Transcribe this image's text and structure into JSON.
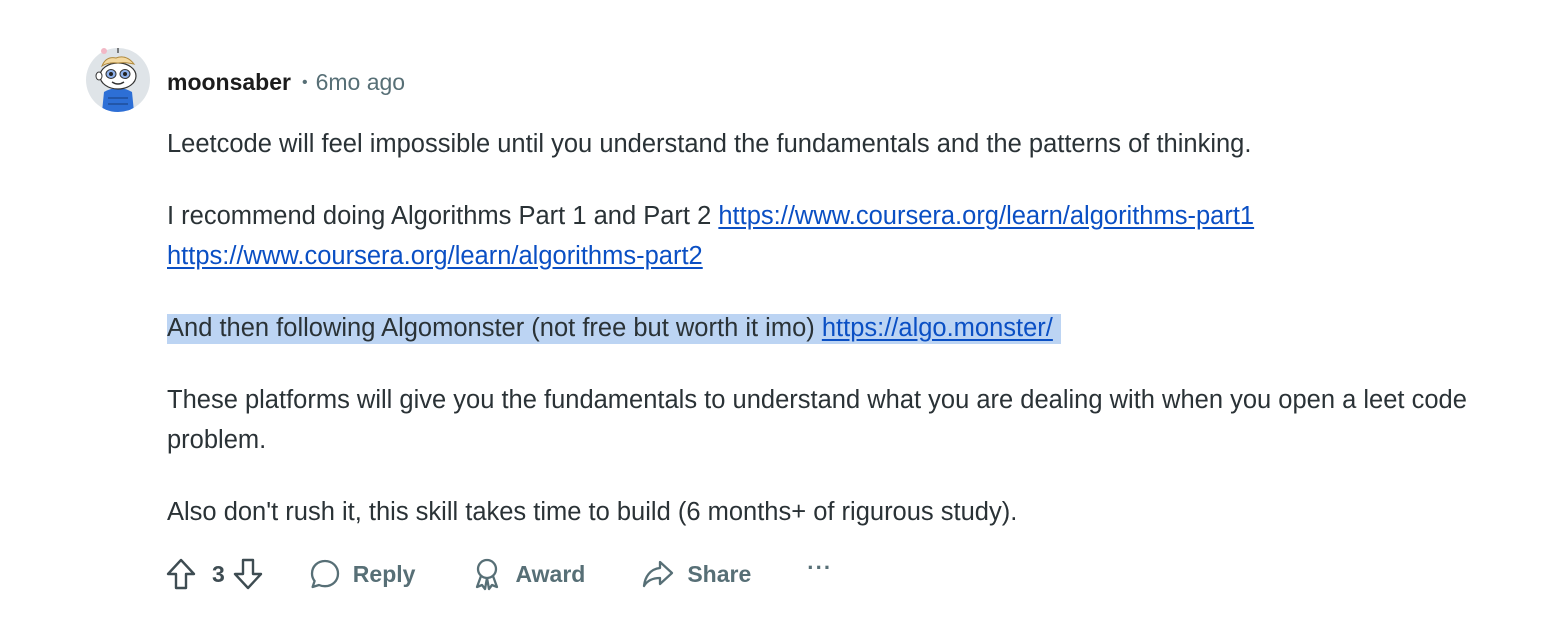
{
  "comment": {
    "author": "moonsaber",
    "separator": "•",
    "time": "6mo ago",
    "avatar_icon": "snoo-avatar-icon",
    "paragraphs": {
      "p1": "Leetcode will feel impossible until you understand the fundamentals and the patterns of thinking.",
      "p2_text": "I recommend doing Algorithms Part 1 and Part 2 ",
      "p2_link1": "https://www.coursera.org/learn/algorithms-part1",
      "p2_link2": "https://www.coursera.org/learn/algorithms-part2",
      "p3_text": "And then following Algomonster (not free but worth it imo) ",
      "p3_link": "https://algo.monster/",
      "p4": "These platforms will give you the fundamentals to understand what you are dealing with when you open a leet code problem.",
      "p5": "Also don't rush it, this skill takes time to build (6 months+ of rigurous study)."
    },
    "actions": {
      "upvote_icon": "upvote-arrow-icon",
      "vote_count": "3",
      "downvote_icon": "downvote-arrow-icon",
      "reply_label": "Reply",
      "reply_icon": "speech-bubble-icon",
      "award_label": "Award",
      "award_icon": "award-ribbon-icon",
      "share_label": "Share",
      "share_icon": "share-arrow-icon",
      "more_label": "···"
    }
  },
  "colors": {
    "text": "#2a3236",
    "meta": "#576f76",
    "link": "#0a4fc4",
    "highlight": "#bcd4f3"
  }
}
